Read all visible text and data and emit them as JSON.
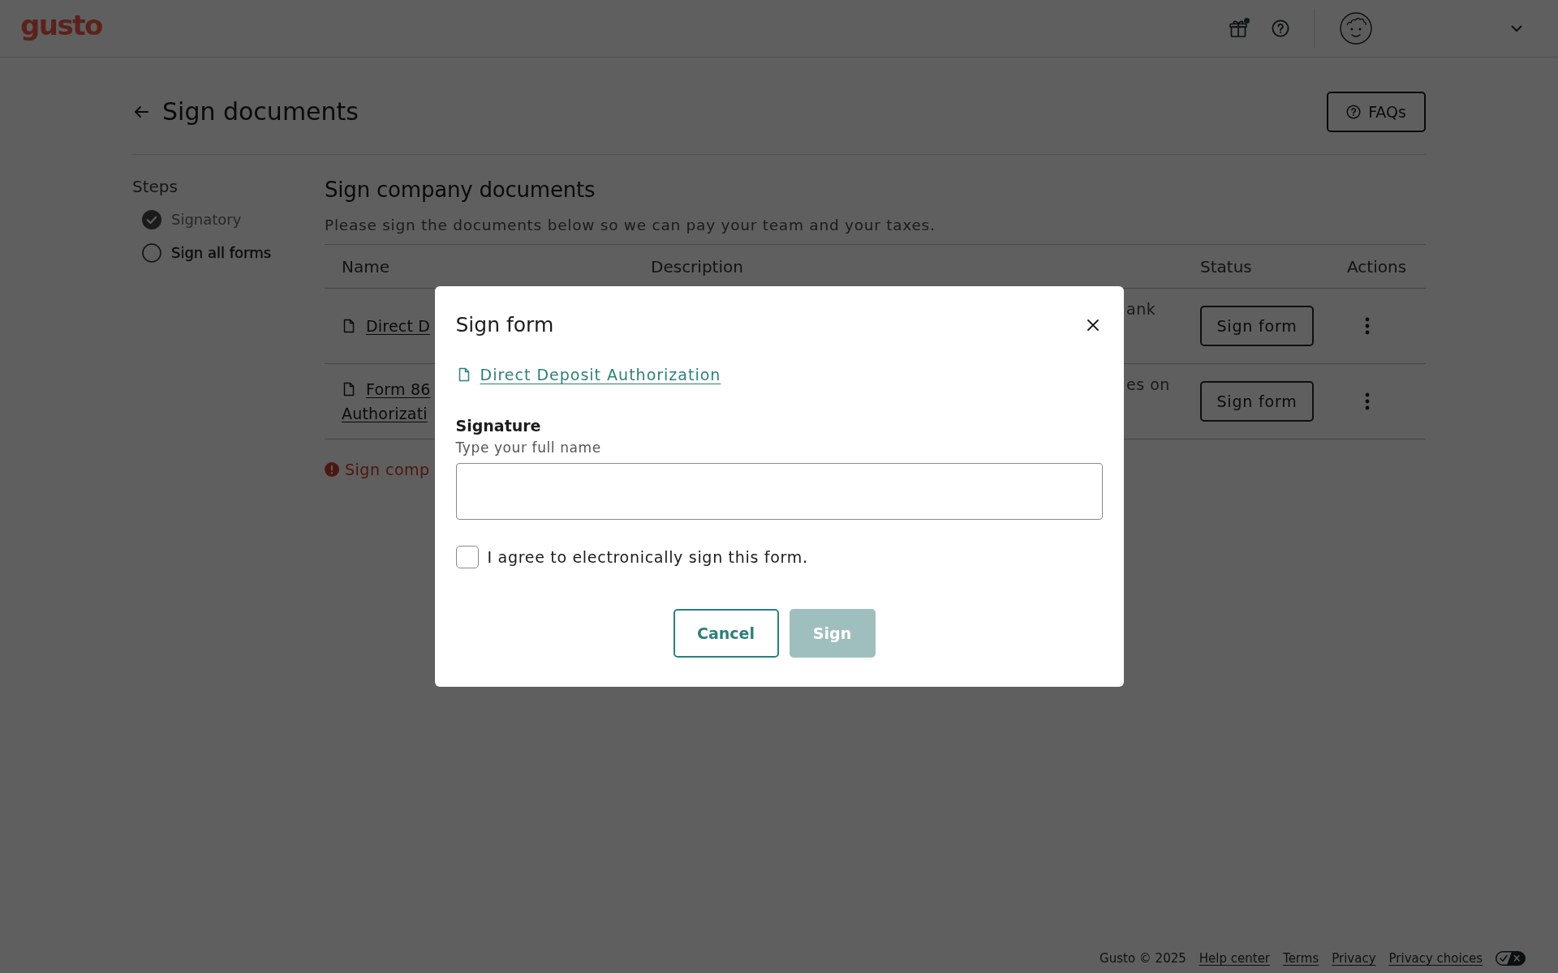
{
  "header": {
    "logo": "gusto",
    "gift_notification": true
  },
  "page": {
    "title": "Sign documents",
    "faq_button": "FAQs"
  },
  "steps": {
    "heading": "Steps",
    "items": [
      {
        "label": "Signatory",
        "completed": true,
        "current": false
      },
      {
        "label": "Sign all forms",
        "completed": false,
        "current": true
      }
    ]
  },
  "main": {
    "title": "Sign company documents",
    "subtitle": "Please sign the documents below so we can pay your team and your taxes.",
    "table": {
      "columns": [
        "Name",
        "Description",
        "Status",
        "Actions"
      ],
      "rows": [
        {
          "name_lines": [
            "Direct D"
          ],
          "description": "ank",
          "status_button": "Sign form"
        },
        {
          "name_lines": [
            "Form 86",
            "Authorizati"
          ],
          "description": "es on",
          "status_button": "Sign form"
        }
      ]
    },
    "error": "Sign comp"
  },
  "modal": {
    "title": "Sign form",
    "document_link": "Direct Deposit Authorization",
    "signature": {
      "label": "Signature",
      "description": "Type your full name"
    },
    "agree": {
      "label": "I agree to electronically sign this form.",
      "checked": false
    },
    "buttons": [
      {
        "label": "Cancel",
        "kind": "secondary",
        "disabled": false
      },
      {
        "label": "Sign",
        "kind": "primary",
        "disabled": true
      }
    ]
  },
  "footer": {
    "copyright": "Gusto © 2025",
    "links": [
      "Help center",
      "Terms",
      "Privacy",
      "Privacy choices"
    ]
  }
}
